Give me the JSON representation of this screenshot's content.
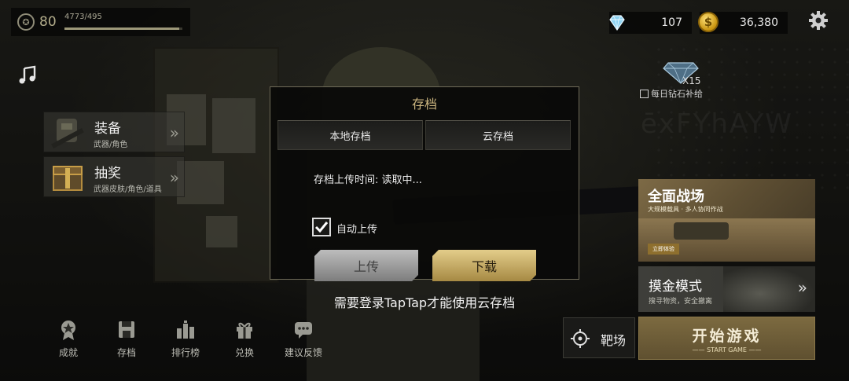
{
  "player": {
    "level": "80",
    "xp_text": "4773/495",
    "xp_fraction": 0.97
  },
  "currency": {
    "diamonds": "107",
    "coins": "36,380",
    "coin_symbol": "$"
  },
  "left_menu": [
    {
      "title": "装备",
      "subtitle": "武器/角色",
      "chevron": "»"
    },
    {
      "title": "抽奖",
      "subtitle": "武器皮肤/角色/道具",
      "chevron": "»"
    }
  ],
  "dialog": {
    "title": "存档",
    "tabs": [
      "本地存档",
      "云存档"
    ],
    "upload_time": "存档上传时间: 读取中...",
    "auto_upload_label": "自动上传",
    "auto_upload_checked": true,
    "upload_button": "上传",
    "download_button": "下载"
  },
  "notice": "需要登录TapTap才能使用云存档",
  "daily": {
    "count": "X15",
    "label": "每日钻石补给"
  },
  "modes": {
    "battlefield_title": "全面战场",
    "battlefield_subtitle": "大规模载具 · 多人协同作战",
    "battlefield_tag": "立即体验",
    "gold_title": "摸金模式",
    "gold_subtitle": "搜寻物资，安全撤离",
    "gold_chevron": "»"
  },
  "range_button": "靶场",
  "start": {
    "title": "开始游戏",
    "subtitle": "—— START GAME ——"
  },
  "bottom_nav": [
    {
      "label": "成就",
      "icon": "medal-icon"
    },
    {
      "label": "存档",
      "icon": "save-icon"
    },
    {
      "label": "排行榜",
      "icon": "leaderboard-icon"
    },
    {
      "label": "兑换",
      "icon": "gift-icon"
    },
    {
      "label": "建议反馈",
      "icon": "feedback-icon"
    }
  ],
  "colors": {
    "accent_gold": "#cbb57f",
    "download_gold": "#e3cd8a",
    "upload_gray": "#bdbdbd"
  }
}
